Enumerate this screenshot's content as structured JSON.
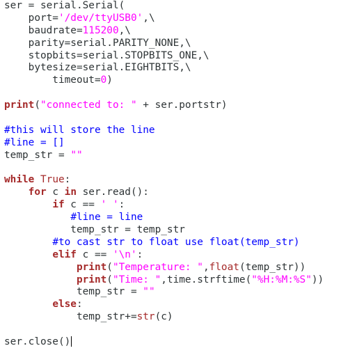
{
  "editor": {
    "lines": [
      "ser = serial.Serial(",
      "    port='/dev/ttyUSB0',\\",
      "    baudrate=115200,\\",
      "    parity=serial.PARITY_NONE,\\",
      "    stopbits=serial.STOPBITS_ONE,\\",
      "    bytesize=serial.EIGHTBITS,\\",
      "        timeout=0)",
      "",
      "print(\"connected to: \" + ser.portstr)",
      "",
      "#this will store the line",
      "#line = []",
      "temp_str = \"\"",
      "",
      "while True:",
      "    for c in ser.read():",
      "        if c == ' ':",
      "           #line = line",
      "           temp_str = temp_str",
      "        #to cast str to float use float(temp_str)",
      "        elif c == '\\n':",
      "            print(\"Temperature: \",float(temp_str))",
      "            print(\"Time: \",time.strftime(\"%H:%M:%S\"))",
      "            temp_str = \"\"",
      "        else:",
      "            temp_str+=str(c)",
      "",
      "ser.close()"
    ],
    "colors": {
      "keyword": "#a52a2a",
      "string": "#ff00ff",
      "comment": "#0000ff",
      "text": "#2e3436",
      "background": "#ffffff"
    }
  }
}
